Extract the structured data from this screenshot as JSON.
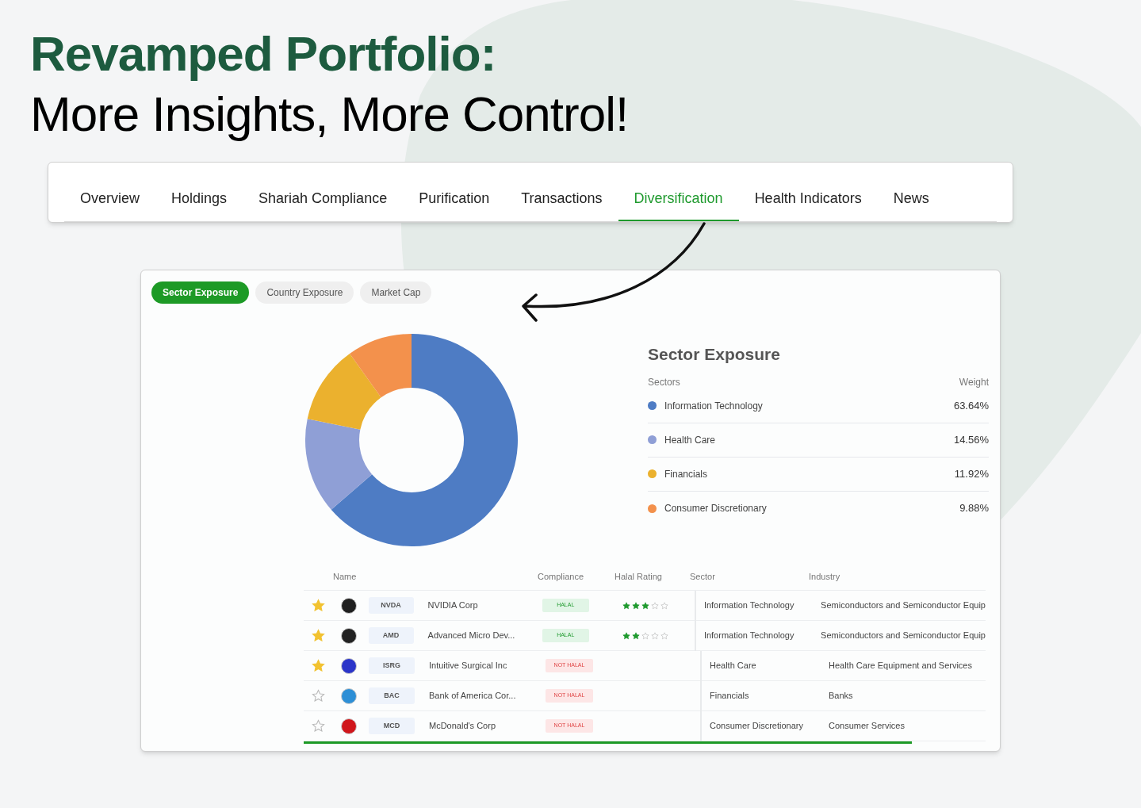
{
  "headline": {
    "title": "Revamped Portfolio:",
    "subtitle": "More Insights, More Control!"
  },
  "tabs": [
    {
      "label": "Overview",
      "selected": false
    },
    {
      "label": "Holdings",
      "selected": false
    },
    {
      "label": "Shariah Compliance",
      "selected": false
    },
    {
      "label": "Purification",
      "selected": false
    },
    {
      "label": "Transactions",
      "selected": false
    },
    {
      "label": "Diversification",
      "selected": true
    },
    {
      "label": "Health Indicators",
      "selected": false
    },
    {
      "label": "News",
      "selected": false
    }
  ],
  "exposure_tabs": [
    {
      "label": "Sector Exposure",
      "selected": true
    },
    {
      "label": "Country Exposure",
      "selected": false
    },
    {
      "label": "Market Cap",
      "selected": false
    }
  ],
  "chart": {
    "chart_data": {
      "type": "donut",
      "categories": [
        "Information Technology",
        "Health Care",
        "Financials",
        "Consumer Discretionary"
      ],
      "series": [
        {
          "name": "Weight",
          "values": [
            63.64,
            14.56,
            11.92,
            9.88
          ]
        }
      ]
    }
  },
  "legend": {
    "title": "Sector Exposure",
    "columns": [
      "Sectors"
    ],
    "rows": [
      {
        "weight": "63.64%",
        "color": "#4e7cc4"
      },
      {
        "weight": "14.56%",
        "color": "#8f9fd6"
      },
      {
        "weight": "11.92%",
        "color": "#ebb12e"
      },
      {
        "weight": "9.88%",
        "color": "#f3914c"
      }
    ]
  },
  "table": {
    "columns": [
      "Name",
      "Compliance",
      "Halal Rating",
      "Sector",
      "Industry"
    ],
    "rows": [
      {
        "favorite": true,
        "ticker": "NVDA",
        "name": "NVIDIA Corp",
        "compliance": "HALAL",
        "kind": "halal",
        "stars": 3,
        "sector": "Information Technology",
        "industry": "Semiconductors and Semiconductor Equip"
      },
      {
        "favorite": true,
        "ticker": "AMD",
        "name": "Advanced Micro Dev...",
        "compliance": "HALAL",
        "kind": "halal",
        "stars": 2,
        "sector": "Information Technology",
        "industry": "Semiconductors and Semiconductor Equip"
      },
      {
        "favorite": true,
        "ticker": "ISRG",
        "name": "Intuitive Surgical Inc",
        "compliance": "NOT HALAL",
        "kind": "not_halal",
        "sector": "Health Care",
        "industry": "Health Care Equipment and Services"
      },
      {
        "favorite": false,
        "ticker": "BAC",
        "name": "Bank of America Cor...",
        "compliance": "NOT HALAL",
        "kind": "not_halal",
        "sector": "Financials",
        "industry": "Banks"
      },
      {
        "favorite": false,
        "ticker": "MCD",
        "name": "McDonald's Corp",
        "compliance": "NOT HALAL",
        "kind": "not_halal",
        "sector": "Consumer Discretionary",
        "industry": "Consumer Services"
      }
    ]
  }
}
